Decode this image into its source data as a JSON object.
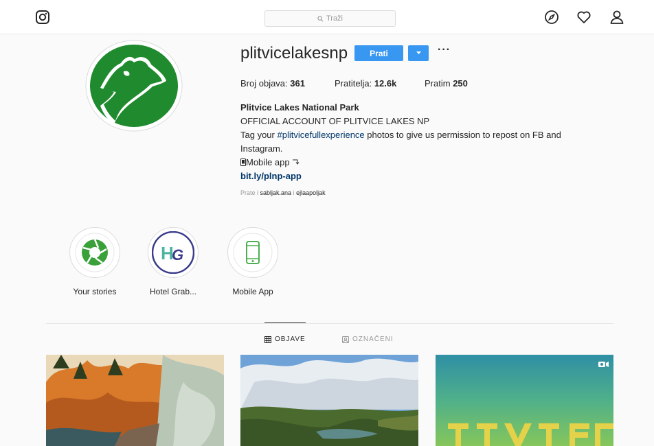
{
  "header": {
    "search_placeholder": "Traži",
    "icons": [
      "instagram-logo-icon",
      "search-icon",
      "compass-icon",
      "heart-icon",
      "user-icon"
    ]
  },
  "profile": {
    "username": "plitvicelakesnp",
    "follow_label": "Prati",
    "more_label": "···",
    "stats": {
      "posts_label": "Broj objava:",
      "posts_value": "361",
      "followers_label": "Pratitelja:",
      "followers_value": "12.6k",
      "following_label": "Pratim",
      "following_value": "250"
    },
    "bio": {
      "full_name": "Plitvice Lakes National Park",
      "line1": "OFFICIAL ACCOUNT OF PLITVICE LAKES NP",
      "tag_prefix": "Tag your ",
      "hashtag": "#plitvicefullexperience",
      "tag_suffix": " photos to give us permission to repost on FB and Instagram.",
      "mobile_line": "Mobile app",
      "link": "bit.ly/plnp-app"
    },
    "followed_by": {
      "prefix": "Prate i ",
      "user1": "sabljak.ana",
      "sep": " i ",
      "user2": "ejlaapoljak"
    }
  },
  "highlights": [
    {
      "label": "Your stories"
    },
    {
      "label": "Hotel Grab..."
    },
    {
      "label": "Mobile App"
    }
  ],
  "tabs": [
    {
      "label": "OBJAVE",
      "active": true
    },
    {
      "label": "OZNAČENI",
      "active": false
    }
  ],
  "colors": {
    "accent": "#3897f0",
    "brand_green": "#1f8a2e",
    "link": "#003569"
  }
}
